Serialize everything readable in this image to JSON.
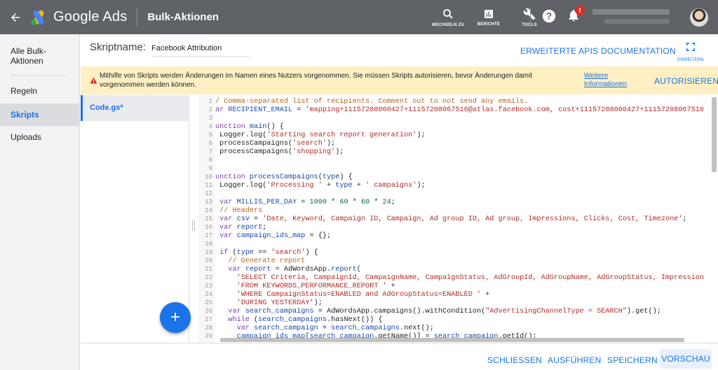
{
  "topbar": {
    "app_name": "Google Ads",
    "page_label": "Bulk-Aktionen",
    "nav": [
      {
        "label": "WECHSELN ZU",
        "icon": "search-icon"
      },
      {
        "label": "BERICHTE",
        "icon": "reports-icon"
      },
      {
        "label": "TOOLS",
        "icon": "wrench-icon"
      }
    ],
    "notification_badge": "!"
  },
  "sidebar": {
    "items": [
      {
        "label": "Alle Bulk-Aktionen"
      },
      {
        "label": "Regeln"
      },
      {
        "label": "Skripts",
        "active": true
      },
      {
        "label": "Uploads"
      }
    ]
  },
  "header": {
    "script_label": "Skriptname:",
    "script_name": "Facebook Attribution",
    "links": [
      "ERWEITERTE APIS",
      "DOCUMENTATION"
    ],
    "expand_label": "ERWEITERN"
  },
  "warning": {
    "text": "Mithilfe von Skripts werden Änderungen im Namen eines Nutzers vorgenommen. Sie müssen Skripts autorisieren, bevor Änderungen damit vorgenommen werden können.",
    "link": "Weitere Informationen",
    "button": "AUTORISIEREN"
  },
  "files": {
    "active_file": "Code.gs*",
    "add_button": "+"
  },
  "editor": {
    "lines": [
      "/ Comma-separated list of recipients. Comment out to not send any emails.",
      "ar RECIPIENT_EMAIL = 'mapping+11157208060427+11157208067516@atlas.facebook.com, cost+11157208060427+11157208067516",
      "",
      "unction main() {",
      " Logger.log('Starting search report generation');",
      " processCampaigns('search');",
      " processCampaigns('shopping');",
      "",
      "",
      "unction processCampaigns(type) {",
      " Logger.log('Processing ' + type + ' campaigns');",
      "",
      " var MILLIS_PER_DAY = 1000 * 60 * 60 * 24;",
      " // Headers",
      " var csv = 'Date, Keyword, Campaign ID, Campaign, Ad group ID, Ad group, Impressions, Clicks, Cost, Timezone';",
      " var report;",
      " var campaign_ids_map = {};",
      "",
      " if (type == 'search') {",
      "   // Generate report",
      "   var report = AdWordsApp.report(",
      "     'SELECT Criteria, CampaignId, CampaignName, CampaignStatus, AdGroupId, AdGroupName, AdGroupStatus, Impression",
      "     'FROM KEYWORDS_PERFORMANCE_REPORT ' +",
      "     'WHERE CampaignStatus=ENABLED and AdGroupStatus=ENABLED ' +",
      "     'DURING YESTERDAY');",
      "   var search_campaigns = AdWordsApp.campaigns().withCondition(\"AdvertisingChannelType = SEARCH\").get();",
      "   while (search_campaigns.hasNext()) {",
      "     var search_campaign = search_campaigns.next();",
      "     campaign_ids_map[search_campaign.getName()] = search_campaign.getId();"
    ]
  },
  "footer": {
    "buttons": [
      "SCHLIESSEN",
      "AUSFÜHREN",
      "SPEICHERN",
      "VORSCHAU"
    ]
  },
  "colors": {
    "topbar": "#5f6368",
    "accent": "#1a73e8",
    "warning_bg": "#fef0c3",
    "alert": "#d93025"
  }
}
